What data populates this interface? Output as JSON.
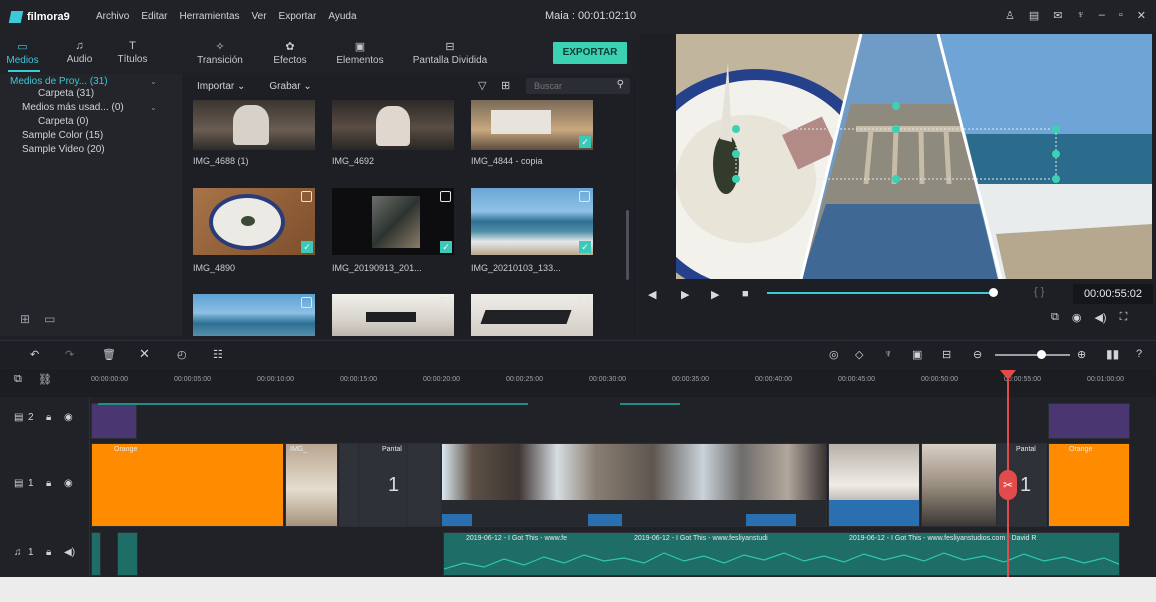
{
  "titlebar": {
    "app_name": "filmora9",
    "menu": [
      "Archivo",
      "Editar",
      "Herramientas",
      "Ver",
      "Exportar",
      "Ayuda"
    ],
    "project_title": "Maia : 00:01:02:10"
  },
  "library_nav": {
    "tabs": [
      {
        "label": "Medios",
        "icon": "folder-icon",
        "active": true
      },
      {
        "label": "Audio",
        "icon": "music-note-icon"
      },
      {
        "label": "Títulos",
        "icon": "text-icon"
      }
    ]
  },
  "library_tabs": [
    {
      "label": "Transición",
      "icon": "transition-icon"
    },
    {
      "label": "Efectos",
      "icon": "effects-icon"
    },
    {
      "label": "Elementos",
      "icon": "elements-icon"
    },
    {
      "label": "Pantalla Dividida",
      "icon": "split-screen-icon"
    }
  ],
  "export_label": "EXPORTAR",
  "folder_tree": [
    {
      "label": "Medios de Proy... (31)",
      "active": true
    },
    {
      "label": "Carpeta (31)"
    },
    {
      "label": "Medios más usad... (0)"
    },
    {
      "label": "Carpeta (0)"
    },
    {
      "label": "Sample Color (15)"
    },
    {
      "label": "Sample Video (20)"
    }
  ],
  "media_toolbar": {
    "import_label": "Importar",
    "record_label": "Grabar",
    "search_placeholder": "Buscar"
  },
  "media_items": [
    {
      "label": "IMG_4688 (1)",
      "checked": false
    },
    {
      "label": "IMG_4692",
      "checked": false
    },
    {
      "label": "IMG_4844 - copia",
      "checked": true
    },
    {
      "label": "IMG_4890",
      "checked": true
    },
    {
      "label": "IMG_20190913_201...",
      "checked": true
    },
    {
      "label": "IMG_20210103_133...",
      "checked": true
    },
    {
      "label": "",
      "checked": false
    },
    {
      "label": "",
      "checked": false
    },
    {
      "label": "",
      "checked": false
    }
  ],
  "preview": {
    "timecode": "00:00:55:02",
    "braces": "{ }",
    "progress": 0.94
  },
  "ruler_ticks": [
    "00:00:00:00",
    "00:00:05:00",
    "00:00:10:00",
    "00:00:15:00",
    "00:00:20:00",
    "00:00:25:00",
    "00:00:30:00",
    "00:00:35:00",
    "00:00:40:00",
    "00:00:45:00",
    "00:00:50:00",
    "00:00:55:00",
    "00:01:00:00"
  ],
  "tracks": {
    "video2_label": "2",
    "video1_label": "1",
    "audio1_label": "1"
  },
  "clips": {
    "orange_left": "Orange",
    "orange_right": "Orange",
    "img": "IMG_",
    "pantal_1": "Pantal",
    "pantal_2": "Pantal",
    "split_number_1": "1",
    "split_number_2": "1",
    "audio_text_1": "2019-06-12 - I Got This - www.fe",
    "audio_text_2": "2019-06-12 - I Got This - www.fesliyanstudi",
    "audio_text_3": "2019-06-12 - I Got This - www.fesliyanstudios.com - David R"
  },
  "colors": {
    "accent": "#3ec9d6",
    "export": "#3bd2b4",
    "orange_clip": "#ff8c00",
    "purple_clip": "#4a3670",
    "playhead": "#e24b4b",
    "audio_wave": "#1e8e86"
  }
}
